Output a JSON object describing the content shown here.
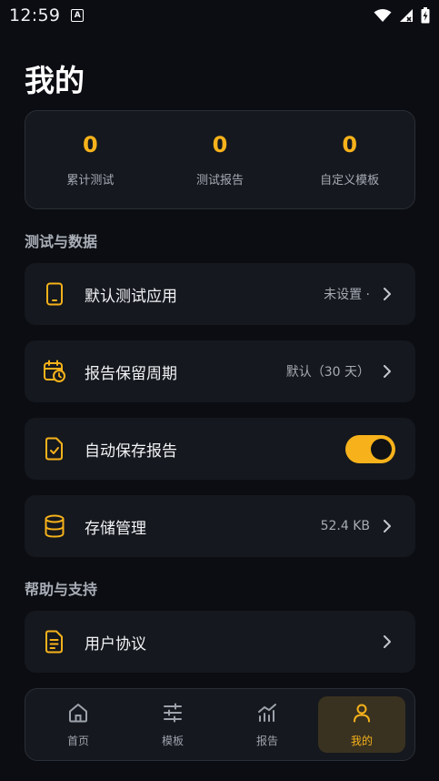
{
  "status": {
    "time": "12:59",
    "notif_glyph": "A"
  },
  "page": {
    "title": "我的"
  },
  "stats": [
    {
      "value": "0",
      "label": "累计测试"
    },
    {
      "value": "0",
      "label": "测试报告"
    },
    {
      "value": "0",
      "label": "自定义模板"
    }
  ],
  "sections": {
    "test_data": "测试与数据",
    "help": "帮助与支持"
  },
  "rows": {
    "default_app": {
      "label": "默认测试应用",
      "value": "未设置 ·"
    },
    "retention": {
      "label": "报告保留周期",
      "value": "默认（30 天）"
    },
    "autosave": {
      "label": "自动保存报告",
      "toggle_on": true
    },
    "storage": {
      "label": "存储管理",
      "value": "52.4 KB"
    },
    "agreement": {
      "label": "用户协议"
    }
  },
  "nav": {
    "tabs": [
      {
        "label": "首页",
        "icon": "home-icon"
      },
      {
        "label": "模板",
        "icon": "sliders-icon"
      },
      {
        "label": "报告",
        "icon": "chart-icon"
      },
      {
        "label": "我的",
        "icon": "person-icon"
      }
    ],
    "active_index": 3
  },
  "colors": {
    "accent": "#f7b21b",
    "background": "#0b0d12",
    "card": "#15181e"
  }
}
